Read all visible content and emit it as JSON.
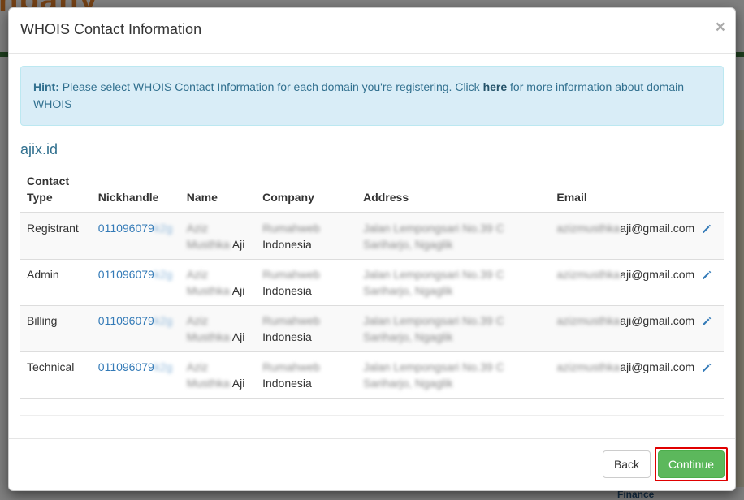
{
  "background": {
    "brand_fragment": "npany",
    "bottom_text": "Finance"
  },
  "modal": {
    "title": "WHOIS Contact Information",
    "close_symbol": "×",
    "hint": {
      "label": "Hint:",
      "text_before": " Please select WHOIS Contact Information for each domain you're registering. Click ",
      "link": "here",
      "text_after": " for more information about domain WHOIS"
    },
    "domain": "ajix.id",
    "table": {
      "headers": {
        "contact_type": "Contact Type",
        "nickhandle": "Nickhandle",
        "name": "Name",
        "company": "Company",
        "address": "Address",
        "email": "Email"
      },
      "rows": [
        {
          "type": "Registrant",
          "nick_visible": "011096079",
          "nick_blur": "k2g",
          "name_blur_1": "Aziz",
          "name_blur_2": "Musthka",
          "name_visible": "Aji",
          "company_blur": "Rumahweb",
          "company_visible": "Indonesia",
          "address_1": "Jalan Lempongsari No.39 C",
          "address_2": "Sariharjo, Ngaglik",
          "email_blur": "azizmusthka",
          "email_visible": "aji@gmail.com"
        },
        {
          "type": "Admin",
          "nick_visible": "011096079",
          "nick_blur": "k2g",
          "name_blur_1": "Aziz",
          "name_blur_2": "Musthka",
          "name_visible": "Aji",
          "company_blur": "Rumahweb",
          "company_visible": "Indonesia",
          "address_1": "Jalan Lempongsari No.39 C",
          "address_2": "Sariharjo, Ngaglik",
          "email_blur": "azizmusthka",
          "email_visible": "aji@gmail.com"
        },
        {
          "type": "Billing",
          "nick_visible": "011096079",
          "nick_blur": "k2g",
          "name_blur_1": "Aziz",
          "name_blur_2": "Musthka",
          "name_visible": "Aji",
          "company_blur": "Rumahweb",
          "company_visible": "Indonesia",
          "address_1": "Jalan Lempongsari No.39 C",
          "address_2": "Sariharjo, Ngaglik",
          "email_blur": "azizmusthka",
          "email_visible": "aji@gmail.com"
        },
        {
          "type": "Technical",
          "nick_visible": "011096079",
          "nick_blur": "k2g",
          "name_blur_1": "Aziz",
          "name_blur_2": "Musthka",
          "name_visible": "Aji",
          "company_blur": "Rumahweb",
          "company_visible": "Indonesia",
          "address_1": "Jalan Lempongsari No.39 C",
          "address_2": "Sariharjo, Ngaglik",
          "email_blur": "azizmusthka",
          "email_visible": "aji@gmail.com"
        }
      ],
      "edit_icon": "pencil-icon"
    },
    "footer": {
      "back_label": "Back",
      "continue_label": "Continue"
    }
  },
  "colors": {
    "primary_link": "#337ab7",
    "hint_bg": "#d9edf7",
    "continue_green": "#5cb85c",
    "highlight_red": "#e00000"
  }
}
